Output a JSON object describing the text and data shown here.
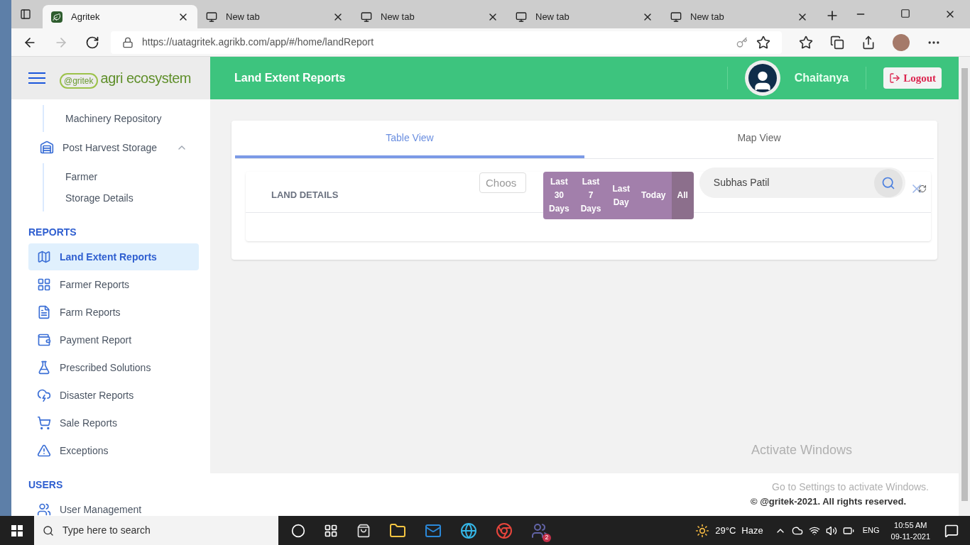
{
  "browser": {
    "tabs": [
      {
        "title": "Agritek",
        "selected": true
      },
      {
        "title": "New tab",
        "selected": false
      },
      {
        "title": "New tab",
        "selected": false
      },
      {
        "title": "New tab",
        "selected": false
      },
      {
        "title": "New tab",
        "selected": false
      }
    ],
    "url": "https://uatagritek.agrikb.com/app/#/home/landReport"
  },
  "logo": {
    "badge": "@gritek",
    "text": "agri ecosystem"
  },
  "header": {
    "title": "Land Extent Reports",
    "user": "Chaitanya",
    "logout": "Logout"
  },
  "sidebar": [
    {
      "kind": "subitem",
      "label": "Machinery Repository",
      "selected": false
    },
    {
      "kind": "group",
      "label": "Post Harvest Storage",
      "expanded": true,
      "children": [
        {
          "label": "Farmer",
          "selected": false
        },
        {
          "label": "Storage Details",
          "selected": false
        }
      ]
    },
    {
      "kind": "heading",
      "label": "REPORTS"
    },
    {
      "kind": "item",
      "label": "Land Extent Reports",
      "selected": true
    },
    {
      "kind": "item",
      "label": "Farmer Reports",
      "selected": false
    },
    {
      "kind": "item",
      "label": "Farm Reports",
      "selected": false
    },
    {
      "kind": "item",
      "label": "Payment Report",
      "selected": false
    },
    {
      "kind": "item",
      "label": "Prescribed Solutions",
      "selected": false
    },
    {
      "kind": "item",
      "label": "Disaster Reports",
      "selected": false
    },
    {
      "kind": "item",
      "label": "Sale Reports",
      "selected": false
    },
    {
      "kind": "item",
      "label": "Exceptions",
      "selected": false
    },
    {
      "kind": "heading",
      "label": "USERS"
    },
    {
      "kind": "item",
      "label": "User Management",
      "selected": false
    }
  ],
  "views": [
    {
      "label": "Table View",
      "selected": true
    },
    {
      "label": "Map View",
      "selected": false
    }
  ],
  "land_details": {
    "title": "LAND DETAILS",
    "date_placeholder": "Choos",
    "filters": [
      {
        "lines": [
          "Last",
          "30",
          "Days"
        ],
        "selected": false
      },
      {
        "lines": [
          "Last",
          "7",
          "Days"
        ],
        "selected": false
      },
      {
        "lines": [
          "Last",
          "Day"
        ],
        "selected": false
      },
      {
        "lines": [
          "Today"
        ],
        "selected": false
      },
      {
        "lines": [
          "All"
        ],
        "selected": true
      }
    ],
    "search": "Subhas Patil"
  },
  "activation": {
    "title": "Activate Windows",
    "hint": "Go to Settings to activate Windows."
  },
  "footer": "© @gritek-2021. All rights reserved.",
  "taskbar": {
    "search_placeholder": "Type here to search",
    "weather": "29°C",
    "condition": "Haze",
    "language": "ENG",
    "time": "10:55 AM",
    "date": "09-11-2021",
    "badge": "2"
  }
}
